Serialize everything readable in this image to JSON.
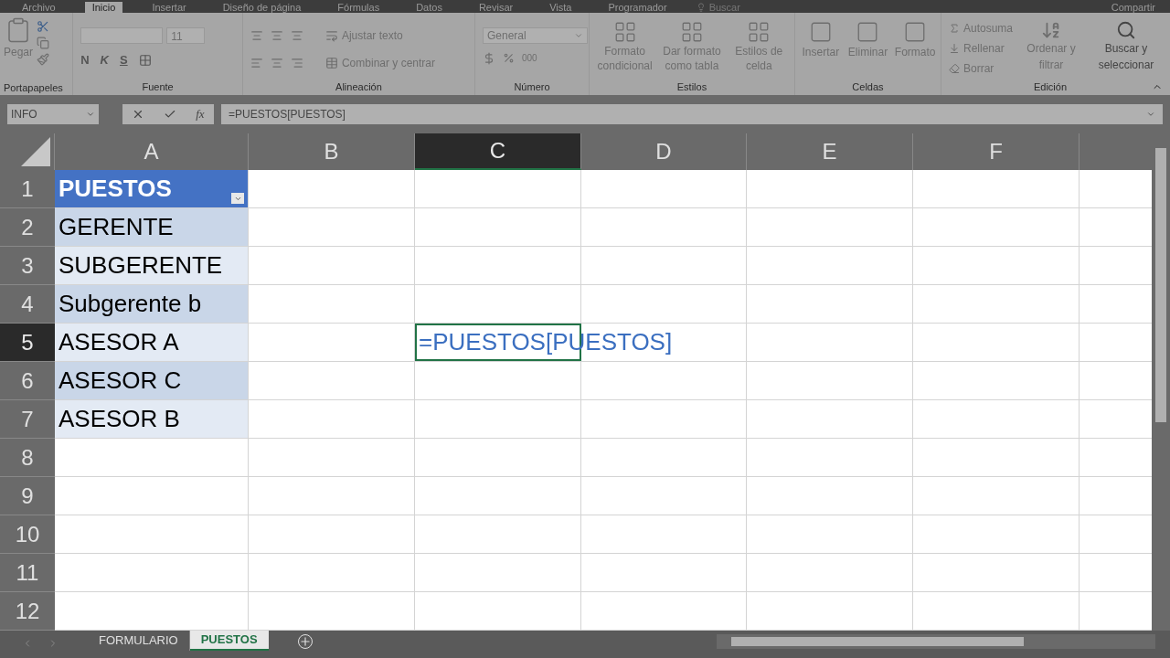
{
  "ribbon_tabs": [
    {
      "label": "Archivo",
      "selected": false
    },
    {
      "label": "Inicio",
      "selected": true
    },
    {
      "label": "Insertar",
      "selected": false
    },
    {
      "label": "Diseño de página",
      "selected": false
    },
    {
      "label": "Fórmulas",
      "selected": false
    },
    {
      "label": "Datos",
      "selected": false
    },
    {
      "label": "Revisar",
      "selected": false
    },
    {
      "label": "Vista",
      "selected": false
    },
    {
      "label": "Programador",
      "selected": false
    }
  ],
  "tell_me": "Buscar",
  "share": "Compartir",
  "ribbon": {
    "paste": "Pegar",
    "clipboard": "Portapapeles",
    "font_group": "Fuente",
    "font_size": "11",
    "bold": "N",
    "italic": "K",
    "underline": "S",
    "alignment_group": "Alineación",
    "wrap_text": "Ajustar texto",
    "merge": "Combinar y centrar",
    "number_format": "General",
    "number_group": "Número",
    "thousands": "000",
    "styles": [
      {
        "label": "Formato condicional"
      },
      {
        "label": "Dar formato como tabla"
      },
      {
        "label": "Estilos de celda"
      }
    ],
    "styles_group": "Estilos",
    "cells": [
      {
        "label": "Insertar"
      },
      {
        "label": "Eliminar"
      },
      {
        "label": "Formato"
      }
    ],
    "cells_group": "Celdas",
    "editing": [
      {
        "label": "Autosuma"
      },
      {
        "label": "Rellenar"
      },
      {
        "label": "Borrar"
      }
    ],
    "sort": "Ordenar y filtrar",
    "find": "Buscar y seleccionar",
    "editing_group": "Edición"
  },
  "name_box": "INFO",
  "insert_function": "fx",
  "formula": "=PUESTOS[PUESTOS]",
  "columns": [
    {
      "label": "A",
      "selected": false
    },
    {
      "label": "B",
      "selected": false
    },
    {
      "label": "C",
      "selected": true
    },
    {
      "label": "D",
      "selected": false
    },
    {
      "label": "E",
      "selected": false
    },
    {
      "label": "F",
      "selected": false
    }
  ],
  "rows": [
    {
      "label": "1",
      "selected": false
    },
    {
      "label": "2",
      "selected": false
    },
    {
      "label": "3",
      "selected": false
    },
    {
      "label": "4",
      "selected": false
    },
    {
      "label": "5",
      "selected": true
    },
    {
      "label": "6",
      "selected": false
    },
    {
      "label": "7",
      "selected": false
    },
    {
      "label": "8",
      "selected": false
    },
    {
      "label": "9",
      "selected": false
    },
    {
      "label": "10",
      "selected": false
    },
    {
      "label": "11",
      "selected": false
    },
    {
      "label": "12",
      "selected": false
    }
  ],
  "table": {
    "header": "PUESTOS",
    "rows": [
      {
        "text": "GERENTE",
        "banded": true
      },
      {
        "text": "SUBGERENTE",
        "banded": false
      },
      {
        "text": "Subgerente b",
        "banded": true
      },
      {
        "text": "ASESOR A",
        "banded": false
      },
      {
        "text": "ASESOR C",
        "banded": true
      },
      {
        "text": "ASESOR B",
        "banded": false
      }
    ]
  },
  "cell_editor": "=PUESTOS[PUESTOS]",
  "sheets": [
    {
      "label": "FORMULARIO",
      "selected": false
    },
    {
      "label": "PUESTOS",
      "selected": true
    }
  ]
}
